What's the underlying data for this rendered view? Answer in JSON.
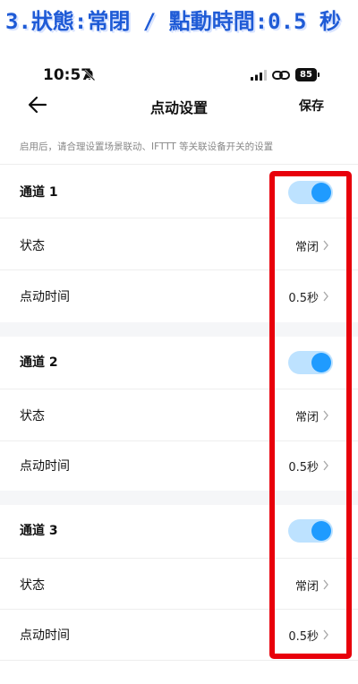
{
  "caption": "3.狀態:常閉 / 點動時間:0.5 秒",
  "status_bar": {
    "time": "10:57",
    "battery": "85"
  },
  "nav": {
    "title": "点动设置",
    "save_label": "保存"
  },
  "hint": "启用后，请合理设置场景联动、IFTTT 等关联设备开关的设置",
  "channels": [
    {
      "name": "通道 1",
      "enabled": true,
      "state_label": "状态",
      "state_value": "常闭",
      "time_label": "点动时间",
      "time_value": "0.5秒"
    },
    {
      "name": "通道 2",
      "enabled": true,
      "state_label": "状态",
      "state_value": "常闭",
      "time_label": "点动时间",
      "time_value": "0.5秒"
    },
    {
      "name": "通道 3",
      "enabled": true,
      "state_label": "状态",
      "state_value": "常闭",
      "time_label": "点动时间",
      "time_value": "0.5秒"
    }
  ],
  "colors": {
    "accent": "#1f9bff",
    "toggle_track": "#bde2ff",
    "highlight": "#e8000b",
    "caption": "#1f5bd6"
  },
  "icons": {
    "back": "arrow-left-icon",
    "chevron": "chevron-right-icon",
    "bell": "bell-slash-icon",
    "signal": "signal-icon",
    "link": "link-icon"
  }
}
